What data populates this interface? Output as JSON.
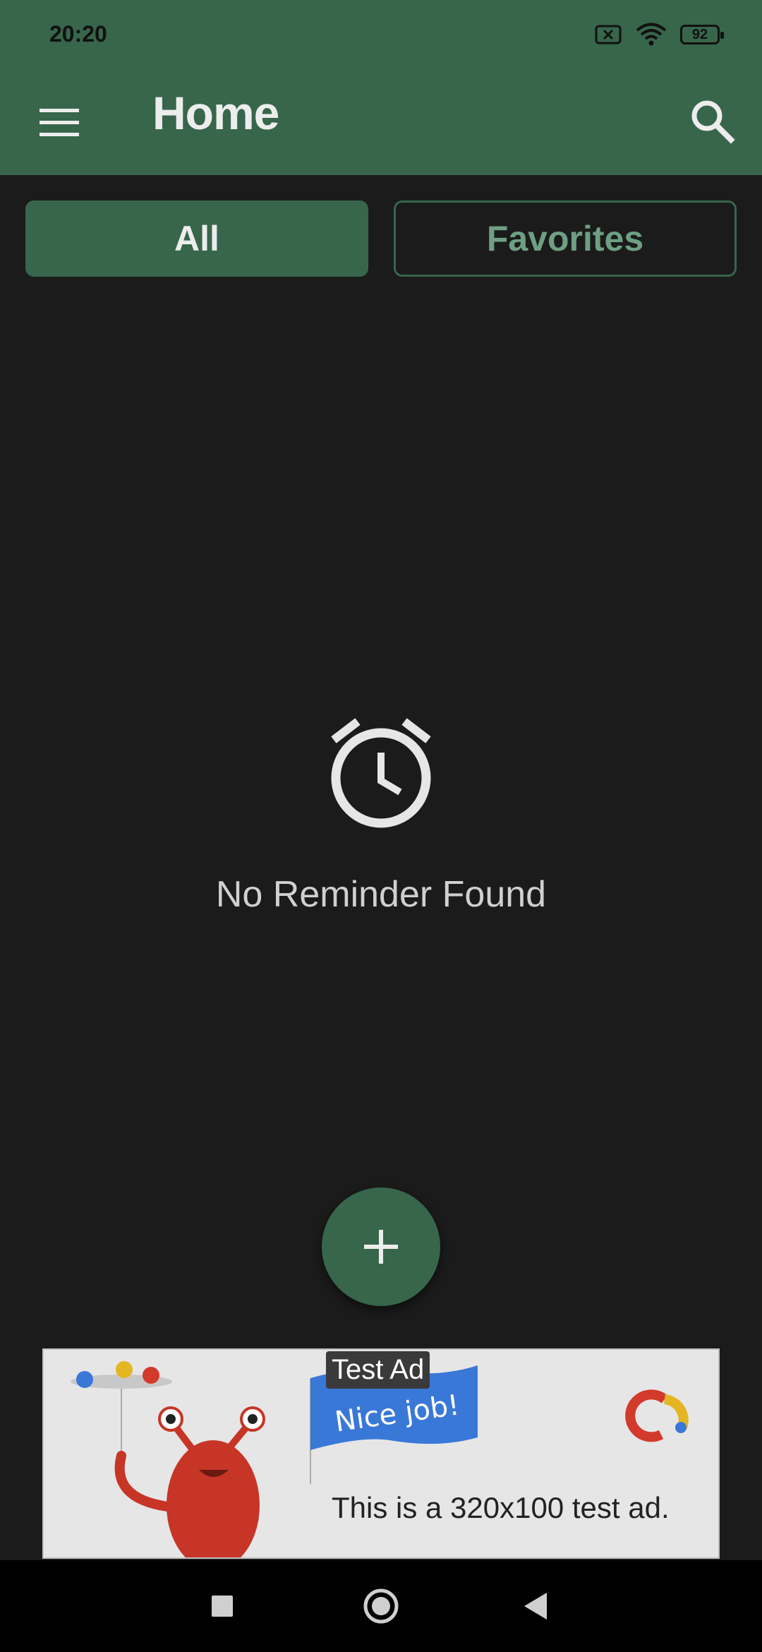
{
  "status_bar": {
    "time": "20:20",
    "battery": "92"
  },
  "app_bar": {
    "title": "Home"
  },
  "tabs": {
    "all": "All",
    "favorites": "Favorites"
  },
  "empty_state": {
    "message": "No Reminder Found"
  },
  "ad": {
    "label": "Test Ad",
    "flag_text": "Nice job!",
    "description": "This is a 320x100 test ad."
  },
  "colors": {
    "primary": "#37664b",
    "background": "#1b1b1b",
    "text_light": "#ededed",
    "tab_outline_text": "#6e9f82"
  },
  "icons": {
    "menu": "menu-icon",
    "search": "search-icon",
    "empty": "alarm-clock-icon",
    "fab": "plus-icon",
    "nav_recents": "square-icon",
    "nav_home": "circle-icon",
    "nav_back": "triangle-back-icon"
  }
}
